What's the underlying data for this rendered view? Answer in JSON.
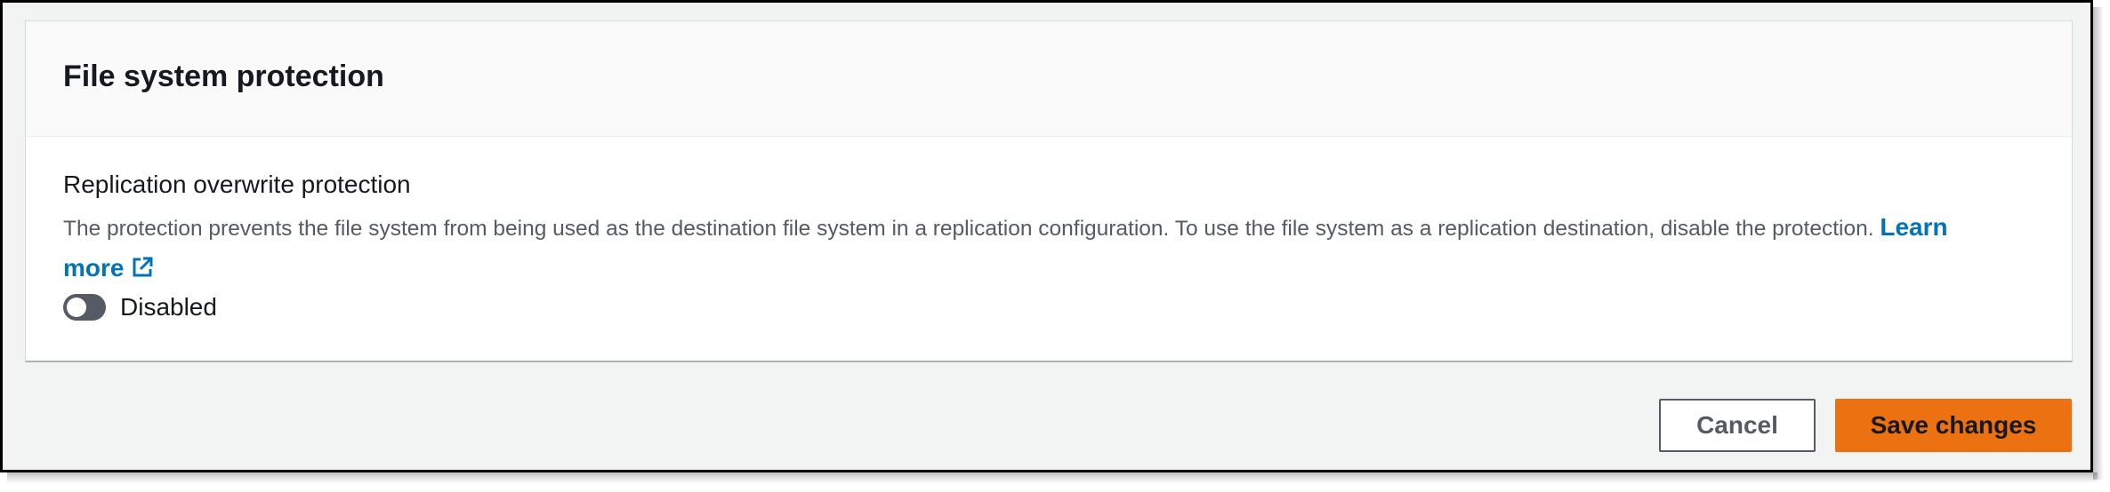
{
  "card": {
    "title": "File system protection"
  },
  "field": {
    "label": "Replication overwrite protection",
    "description": "The protection prevents the file system from being used as the destination file system in a replication configuration. To use the file system as a replication destination, disable the protection.",
    "link_text": "Learn more",
    "link_icon": "external-link-icon"
  },
  "toggle": {
    "state": "off",
    "label": "Disabled"
  },
  "actions": {
    "cancel_label": "Cancel",
    "save_label": "Save changes"
  },
  "colors": {
    "accent": "#ec7211",
    "link": "#0073bb",
    "toggle_off": "#545b64"
  }
}
